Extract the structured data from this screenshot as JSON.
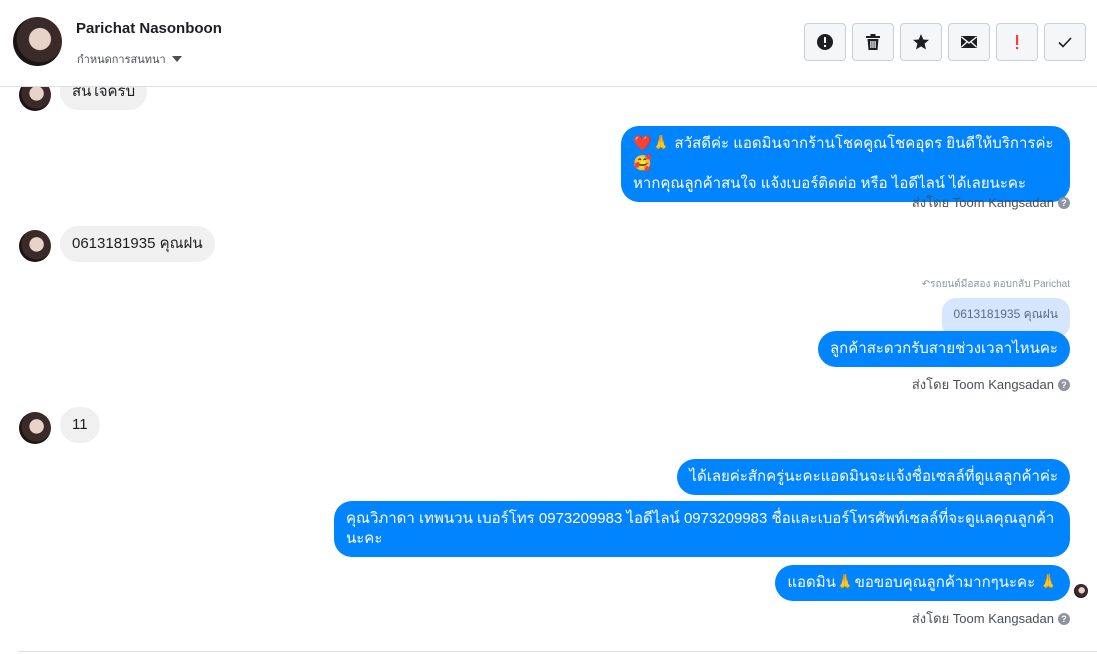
{
  "contact": {
    "name": "Parichat Nasonboon",
    "subtitle": "กำหนดการสนทนา"
  },
  "toolbar": [
    {
      "name": "spam-button",
      "icon": "alert-circle-icon",
      "color": "#1c1e21"
    },
    {
      "name": "delete-button",
      "icon": "trash-icon",
      "color": "#1c1e21"
    },
    {
      "name": "star-button",
      "icon": "star-icon",
      "color": "#1c1e21"
    },
    {
      "name": "mark-unread-button",
      "icon": "envelope-icon",
      "color": "#1c1e21"
    },
    {
      "name": "follow-up-button",
      "icon": "exclamation-icon",
      "color": "#fa3e3e"
    },
    {
      "name": "mark-done-button",
      "icon": "check-icon",
      "color": "#1c1e21"
    }
  ],
  "messages": {
    "m1": "สนใจครับ",
    "m2_line1": "❤️🙏 สวัสดีค่ะ แอดมินจากร้านโชคคูณโชคอุดร ยินดีให้บริการค่ะ🥰",
    "m2_line2": "หากคุณลูกค้าสนใจ แจ้งเบอร์ติดต่อ หรือ ไอดีไลน์ ได้เลยนะคะ",
    "sent_by_1": "ส่งโดย Toom Kangsadan",
    "m3": "0613181935 คุณฝน",
    "reply_meta": "↶รถยนต์มือสอง ตอบกลับ Parichat",
    "quoted": "0613181935 คุณฝน",
    "m4": "ลูกค้าสะดวกรับสายช่วงเวลาไหนคะ",
    "sent_by_2": "ส่งโดย Toom Kangsadan",
    "m5": "11",
    "m6": "ได้เลยค่ะสักครู่นะคะแอดมินจะแจ้งชื่อเซลล์ที่ดูแลลูกค้าค่ะ",
    "m7": "คุณวิภาดา เทพนวน        เบอร์โทร 0973209983  ไอดีไลน์ 0973209983 ชื่อและเบอร์โทรศัพท์เซลล์ที่จะดูแลคุณลูกค้านะคะ",
    "m8": "แอดมิน🙏ขอขอบคุณลูกค้ามากๆนะคะ 🙏",
    "sent_by_3": "ส่งโดย Toom Kangsadan"
  },
  "colors": {
    "outgoing": "#0084ff",
    "incoming": "#f1f0f0",
    "quoted": "#d6e6ff"
  }
}
